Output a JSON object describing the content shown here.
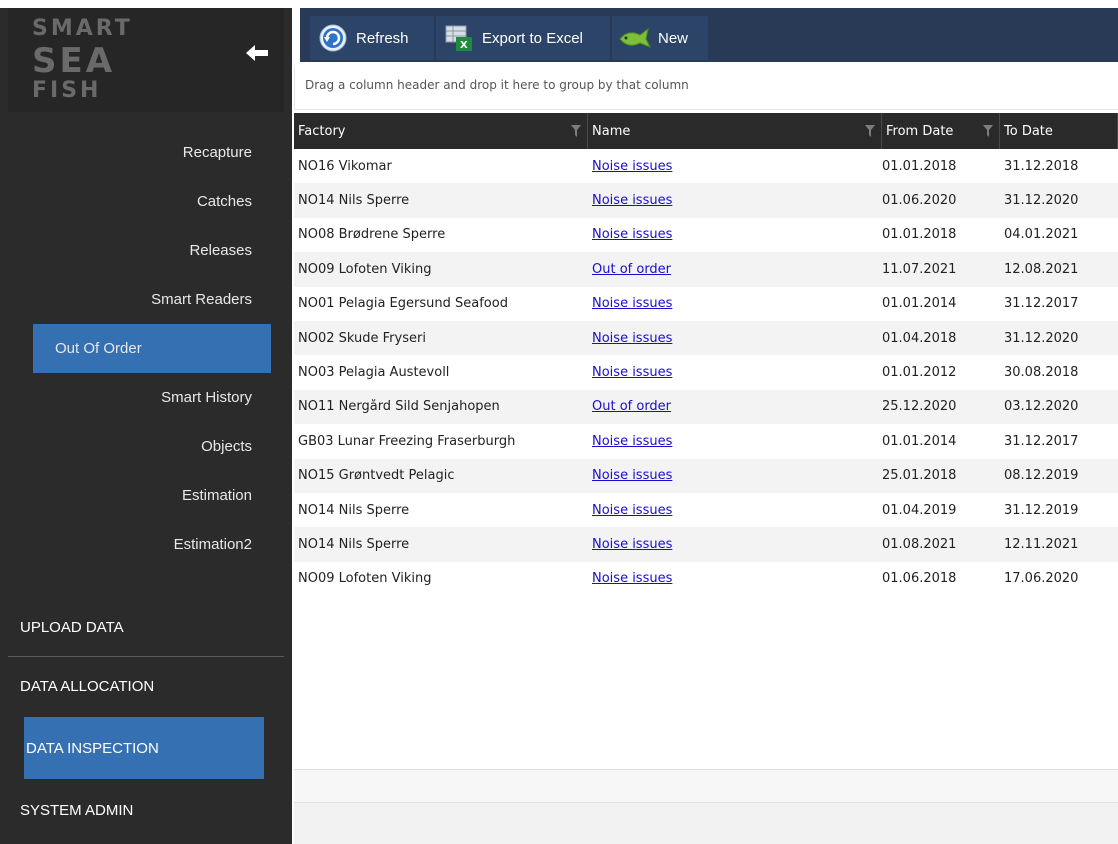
{
  "brand": {
    "line1": "SMART",
    "line2": "SEA",
    "line3": "FISH"
  },
  "sidebar": {
    "subnav": [
      {
        "label": "Recapture"
      },
      {
        "label": "Catches"
      },
      {
        "label": "Releases"
      },
      {
        "label": "Smart Readers"
      },
      {
        "label": "Out Of Order",
        "active": true
      },
      {
        "label": "Smart History"
      },
      {
        "label": "Objects"
      },
      {
        "label": "Estimation"
      },
      {
        "label": "Estimation2"
      }
    ],
    "sections": [
      {
        "label": "UPLOAD DATA"
      },
      {
        "label": "DATA ALLOCATION"
      },
      {
        "label": "DATA INSPECTION",
        "active": true
      },
      {
        "label": "SYSTEM ADMIN"
      }
    ]
  },
  "toolbar": {
    "refresh_label": "Refresh",
    "export_label": "Export to Excel",
    "new_label": "New"
  },
  "grid": {
    "group_hint": "Drag a column header and drop it here to group by that column",
    "columns": [
      "Factory",
      "Name",
      "From Date",
      "To Date"
    ],
    "rows": [
      [
        "NO16 Vikomar",
        "Noise issues",
        "01.01.2018",
        "31.12.2018"
      ],
      [
        "NO14 Nils Sperre",
        "Noise issues",
        "01.06.2020",
        "31.12.2020"
      ],
      [
        "NO08 Brødrene Sperre",
        "Noise issues",
        "01.01.2018",
        "04.01.2021"
      ],
      [
        "NO09 Lofoten Viking",
        "Out of order",
        "11.07.2021",
        "12.08.2021"
      ],
      [
        "NO01 Pelagia Egersund Seafood",
        "Noise issues",
        "01.01.2014",
        "31.12.2017"
      ],
      [
        "NO02 Skude Fryseri",
        "Noise issues",
        "01.04.2018",
        "31.12.2020"
      ],
      [
        "NO03 Pelagia Austevoll",
        "Noise issues",
        "01.01.2012",
        "30.08.2018"
      ],
      [
        "NO11 Nergård Sild Senjahopen",
        "Out of order",
        "25.12.2020",
        "03.12.2020"
      ],
      [
        "GB03 Lunar Freezing Fraserburgh",
        "Noise issues",
        "01.01.2014",
        "31.12.2017"
      ],
      [
        "NO15 Grøntvedt Pelagic",
        "Noise issues",
        "25.01.2018",
        "08.12.2019"
      ],
      [
        "NO14 Nils Sperre",
        "Noise issues",
        "01.04.2019",
        "31.12.2019"
      ],
      [
        "NO14 Nils Sperre",
        "Noise issues",
        "01.08.2021",
        "12.11.2021"
      ],
      [
        "NO09 Lofoten Viking",
        "Noise issues",
        "01.06.2018",
        "17.06.2020"
      ]
    ]
  },
  "colors": {
    "sidebar_bg": "#2b2b2b",
    "accent": "#3470b2",
    "toolbar_bg": "#293a56",
    "link": "#1a0dcc",
    "grid_header": "#2a2a2a"
  }
}
